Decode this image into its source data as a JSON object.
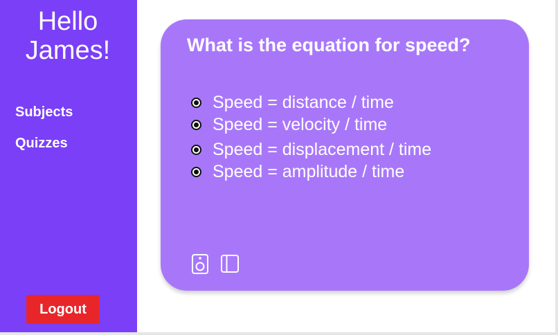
{
  "sidebar": {
    "greeting_line1": "Hello",
    "greeting_line2": "James!",
    "nav": {
      "subjects_label": "Subjects",
      "quizzes_label": "Quizzes"
    },
    "logout_label": "Logout"
  },
  "quiz": {
    "question": "What is the equation for speed?",
    "options": [
      {
        "label": "Speed = distance / time"
      },
      {
        "label": "Speed = velocity / time"
      },
      {
        "label": "Speed = displacement / time"
      },
      {
        "label": "Speed = amplitude / time"
      }
    ],
    "toolbar_icons": [
      "speaker-icon",
      "sidebar-panel-icon"
    ]
  },
  "colors": {
    "sidebar_bg": "#7a3ff7",
    "card_bg": "#a877f9",
    "logout_bg": "#e8262a",
    "text": "#ffffff"
  }
}
